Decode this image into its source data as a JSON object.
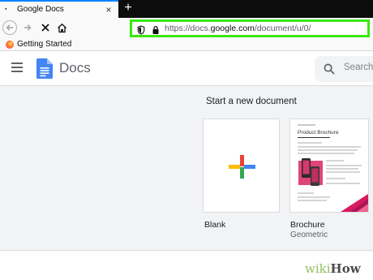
{
  "browser": {
    "tab": {
      "title": "Google Docs",
      "close_glyph": "×"
    },
    "new_tab_glyph": "+",
    "url": {
      "prefix": "https://docs.",
      "domain": "google.com",
      "path": "/document/u/0/"
    },
    "highlight_color": "#38e80c",
    "bookmarks": [
      {
        "label": "Getting Started",
        "icon": "firefox-icon"
      }
    ]
  },
  "docs": {
    "app_title": "Docs",
    "search_placeholder": "Search",
    "gallery": {
      "title": "Start a new document",
      "templates": [
        {
          "label": "Blank",
          "sublabel": ""
        },
        {
          "label": "Brochure",
          "sublabel": "Geometric",
          "preview_title": "Product Brochure"
        }
      ]
    }
  },
  "icons": [
    "back-icon",
    "forward-icon",
    "stop-icon",
    "home-icon",
    "shield-icon",
    "lock-icon",
    "menu-icon",
    "docs-logo-icon",
    "search-icon",
    "plus-icon"
  ],
  "watermark": {
    "wiki": "wiki",
    "how": "How"
  }
}
